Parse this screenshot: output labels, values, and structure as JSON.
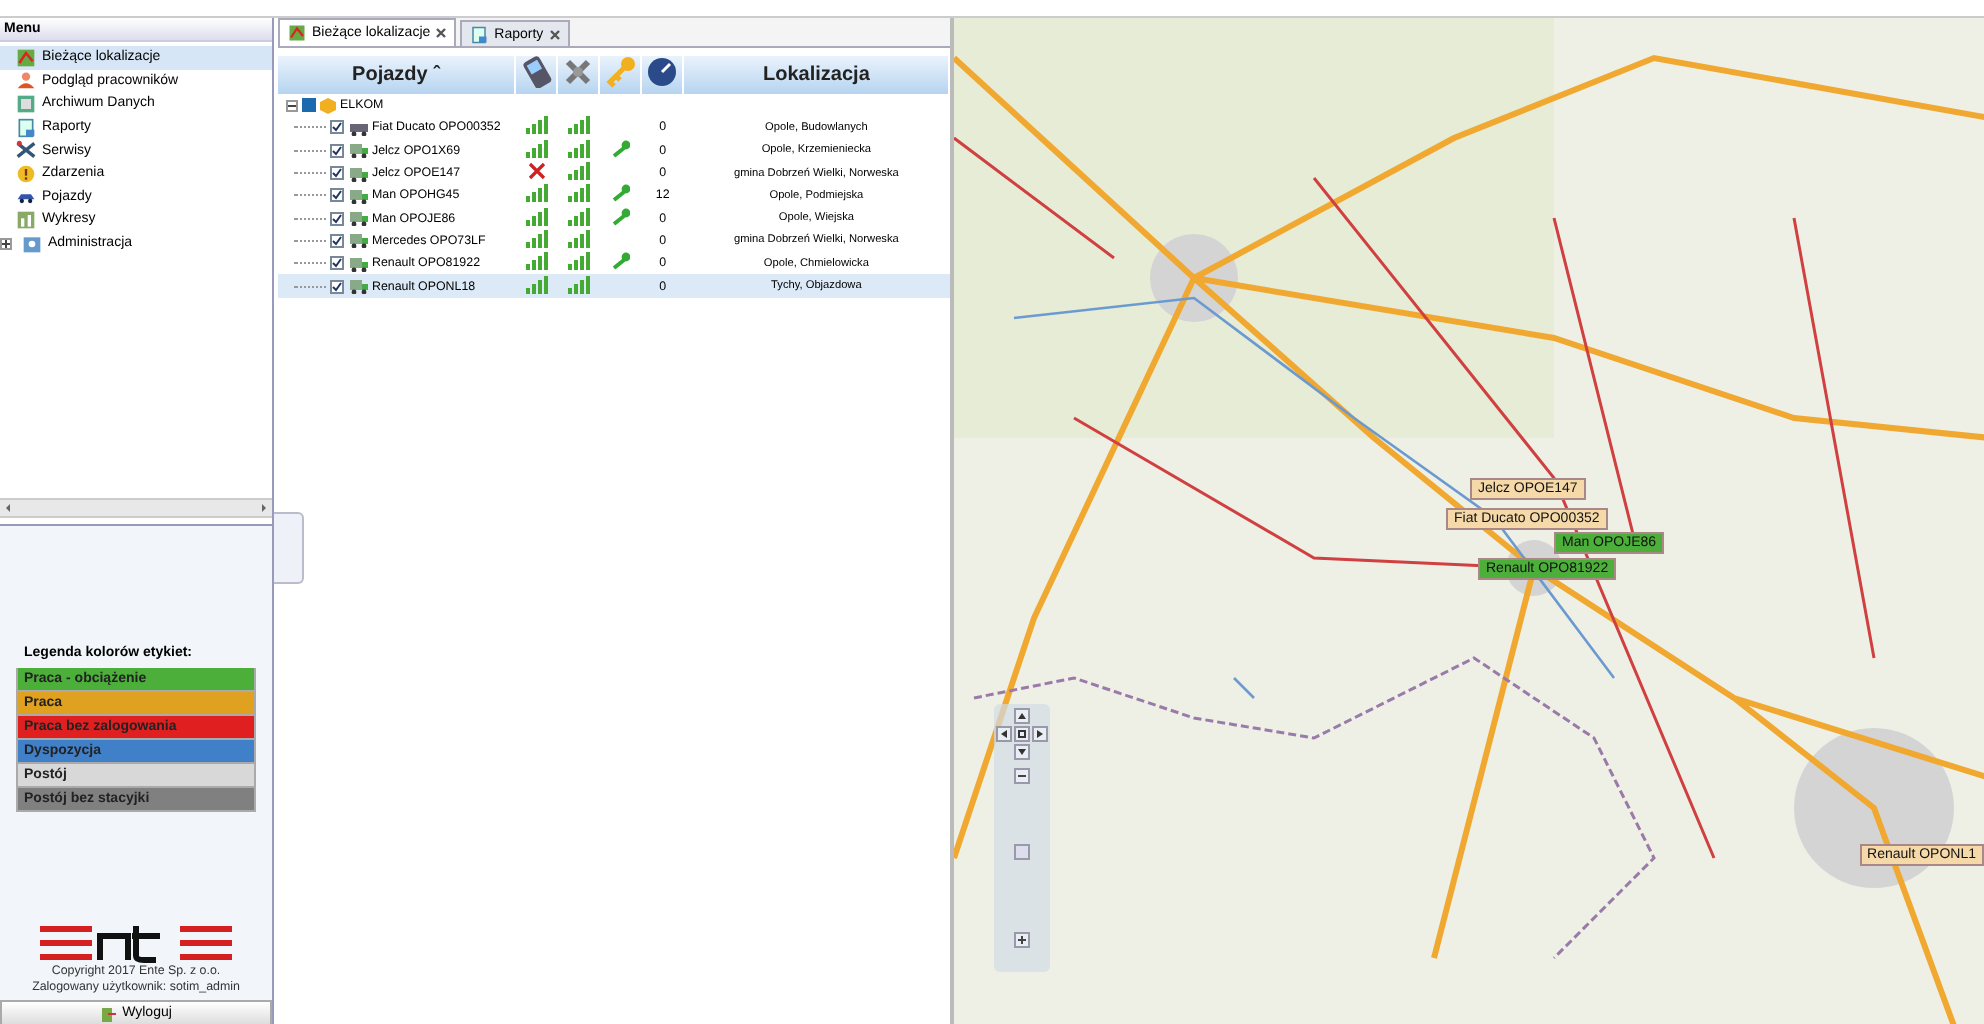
{
  "menu": {
    "title": "Menu",
    "items": [
      {
        "label": "Bieżące lokalizacje",
        "selected": true,
        "expandable": false
      },
      {
        "label": "Podgląd pracowników",
        "selected": false,
        "expandable": false
      },
      {
        "label": "Archiwum Danych",
        "selected": false,
        "expandable": false
      },
      {
        "label": "Raporty",
        "selected": false,
        "expandable": false
      },
      {
        "label": "Serwisy",
        "selected": false,
        "expandable": false
      },
      {
        "label": "Zdarzenia",
        "selected": false,
        "expandable": false
      },
      {
        "label": "Pojazdy",
        "selected": false,
        "expandable": false
      },
      {
        "label": "Wykresy",
        "selected": false,
        "expandable": false
      },
      {
        "label": "Administracja",
        "selected": false,
        "expandable": true
      }
    ]
  },
  "legend": {
    "title": "Legenda kolorów etykiet:",
    "items": [
      {
        "label": "Praca - obciążenie",
        "color": "#4caf3a"
      },
      {
        "label": "Praca",
        "color": "#e0a020"
      },
      {
        "label": "Praca bez zalogowania",
        "color": "#e02020"
      },
      {
        "label": "Dyspozycja",
        "color": "#4080c8"
      },
      {
        "label": "Postój",
        "color": "#d8d8d8"
      },
      {
        "label": "Postój bez stacyjki",
        "color": "#808080"
      }
    ]
  },
  "footer": {
    "copyright": "Copyright 2017 Ente Sp. z o.o.",
    "user": "Zalogowany użytkownik: sotim_admin",
    "logout": "Wyloguj"
  },
  "tabs": [
    {
      "label": "Bieżące lokalizacje",
      "selected": true
    },
    {
      "label": "Raporty",
      "selected": false
    }
  ],
  "table": {
    "columns": [
      {
        "kind": "text",
        "label": "Pojazdy ˆ"
      },
      {
        "kind": "phone"
      },
      {
        "kind": "satellite"
      },
      {
        "kind": "key"
      },
      {
        "kind": "gauge"
      },
      {
        "kind": "text",
        "label": "Lokalizacja"
      }
    ],
    "group": {
      "label": "ELKOM",
      "expanded": true
    },
    "rows": [
      {
        "name": "Fiat Ducato OPO00352",
        "kind": "van",
        "checked": true,
        "gsm": true,
        "gps": true,
        "ignition": false,
        "speed": "0",
        "location": "Opole, Budowlanych",
        "selected": false
      },
      {
        "name": "Jelcz OPO1X69",
        "kind": "truck",
        "checked": true,
        "gsm": true,
        "gps": true,
        "ignition": true,
        "speed": "0",
        "location": "Opole, Krzemieniecka",
        "selected": false
      },
      {
        "name": "Jelcz OPOE147",
        "kind": "truck",
        "checked": true,
        "gsm": false,
        "gps": true,
        "ignition": false,
        "speed": "0",
        "location": "gmina Dobrzeń Wielki, Norweska",
        "selected": false
      },
      {
        "name": "Man OPOHG45",
        "kind": "truck",
        "checked": true,
        "gsm": true,
        "gps": true,
        "ignition": true,
        "speed": "12",
        "location": "Opole, Podmiejska",
        "selected": false
      },
      {
        "name": "Man OPOJE86",
        "kind": "truck",
        "checked": true,
        "gsm": true,
        "gps": true,
        "ignition": true,
        "speed": "0",
        "location": "Opole, Wiejska",
        "selected": false
      },
      {
        "name": "Mercedes OPO73LF",
        "kind": "truck",
        "checked": true,
        "gsm": true,
        "gps": true,
        "ignition": false,
        "speed": "0",
        "location": "gmina Dobrzeń Wielki, Norweska",
        "selected": false
      },
      {
        "name": "Renault OPO81922",
        "kind": "truck",
        "checked": true,
        "gsm": true,
        "gps": true,
        "ignition": true,
        "speed": "0",
        "location": "Opole, Chmielowicka",
        "selected": false
      },
      {
        "name": "Renault OPONL18",
        "kind": "truck",
        "checked": true,
        "gsm": true,
        "gps": true,
        "ignition": false,
        "speed": "0",
        "location": "Tychy, Objazdowa",
        "selected": true
      }
    ]
  },
  "map": {
    "markers": [
      {
        "label": "Jelcz OPOE147",
        "color": "#f5d9a8"
      },
      {
        "label": "Fiat Ducato OPO00352",
        "color": "#f5d9a8"
      },
      {
        "label": "Man OPOJE86",
        "color": "#4caf3a"
      },
      {
        "label": "Renault OPO81922",
        "color": "#4caf3a"
      },
      {
        "label": "Renault OPONL1",
        "color": "#f5d9a8"
      }
    ]
  }
}
